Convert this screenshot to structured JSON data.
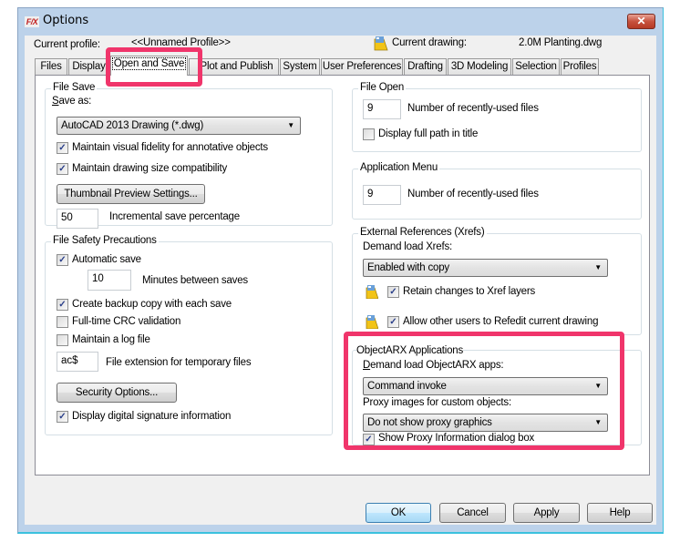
{
  "window": {
    "title": "Options",
    "app_icon": "F/X",
    "close_symbol": "✕"
  },
  "header": {
    "current_profile_label": "Current profile:",
    "current_profile_value": "<<Unnamed Profile>>",
    "current_drawing_label": "Current drawing:",
    "current_drawing_value": "2.0M Planting.dwg"
  },
  "tabs": [
    {
      "label": "Files"
    },
    {
      "label": "Display"
    },
    {
      "label": "Open and Save",
      "active": true
    },
    {
      "label": "Plot and Publish"
    },
    {
      "label": "System"
    },
    {
      "label": "User Preferences"
    },
    {
      "label": "Drafting"
    },
    {
      "label": "3D Modeling"
    },
    {
      "label": "Selection"
    },
    {
      "label": "Profiles"
    }
  ],
  "file_save": {
    "title": "File Save",
    "save_as_label": "Save as:",
    "save_as_value": "AutoCAD 2013 Drawing (*.dwg)",
    "visual_fidelity_label": "Maintain visual fidelity for annotative objects",
    "visual_fidelity_checked": true,
    "size_compat_label": "Maintain drawing size compatibility",
    "size_compat_checked": true,
    "thumbnail_button": "Thumbnail Preview Settings...",
    "incremental_value": "50",
    "incremental_label": "Incremental save percentage"
  },
  "file_safety": {
    "title": "File Safety Precautions",
    "autosave_label": "Automatic save",
    "autosave_checked": true,
    "minutes_value": "10",
    "minutes_label": "Minutes between saves",
    "backup_label": "Create backup copy with each save",
    "backup_checked": true,
    "crc_label": "Full-time CRC validation",
    "crc_checked": false,
    "log_label": "Maintain a log file",
    "log_checked": false,
    "temp_ext_value": "ac$",
    "temp_ext_label": "File extension for temporary files",
    "security_button": "Security Options...",
    "digital_sig_label": "Display digital signature information",
    "digital_sig_checked": true
  },
  "file_open": {
    "title": "File Open",
    "recent_value": "9",
    "recent_label": "Number of recently-used files",
    "full_path_label": "Display full path in title",
    "full_path_checked": false
  },
  "app_menu": {
    "title": "Application Menu",
    "recent_value": "9",
    "recent_label": "Number of recently-used files"
  },
  "xrefs": {
    "title": "External References (Xrefs)",
    "demand_load_label": "Demand load Xrefs:",
    "demand_load_value": "Enabled with copy",
    "retain_label": "Retain changes to Xref layers",
    "retain_checked": true,
    "refedit_label": "Allow other users to Refedit current drawing",
    "refedit_checked": true
  },
  "objectarx": {
    "title": "ObjectARX Applications",
    "demand_load_label": "Demand load ObjectARX apps:",
    "demand_load_value": "Command invoke",
    "proxy_label": "Proxy images for custom objects:",
    "proxy_value": "Do not show proxy graphics",
    "show_proxy_label": "Show Proxy Information dialog box",
    "show_proxy_checked": true
  },
  "footer": {
    "ok": "OK",
    "cancel": "Cancel",
    "apply": "Apply",
    "help": "Help"
  },
  "colors": {
    "highlight": "#f0356b",
    "title_bar": "#bcd2ea",
    "close_button": "#c7523e"
  },
  "check_mark": "✓",
  "dropdown_arrow": "▼"
}
